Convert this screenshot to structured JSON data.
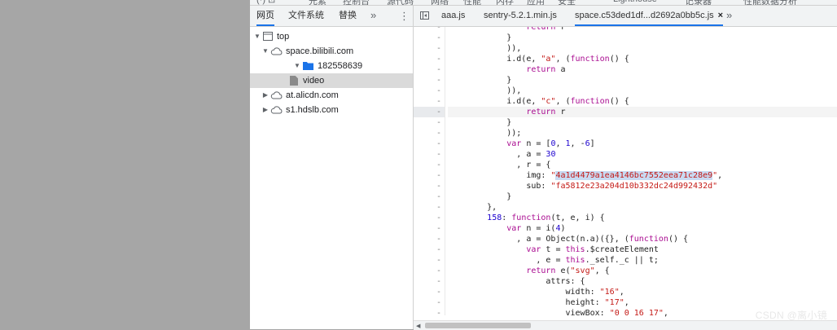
{
  "top_toolbar": {
    "fragments": [
      "(·) ⊡",
      "元素",
      "控制台",
      "源代码",
      "网络",
      "性能",
      "内存",
      "应用",
      "安全",
      "Lighthouse",
      "记录器",
      "性能数据分析"
    ]
  },
  "navigator": {
    "tabs": [
      {
        "label": "网页",
        "active": true
      },
      {
        "label": "文件系统",
        "active": false
      },
      {
        "label": "替换",
        "active": false
      }
    ],
    "more": "»",
    "menu": "⋮",
    "tree": [
      {
        "label": "top",
        "icon": "frame-icon",
        "expanded": true,
        "selected": false
      },
      {
        "label": "space.bilibili.com",
        "icon": "cloud-icon",
        "expanded": true,
        "selected": false
      },
      {
        "label": "182558639",
        "icon": "folder-icon",
        "expanded": true,
        "selected": false
      },
      {
        "label": "video",
        "icon": "file-icon",
        "expanded": false,
        "selected": true
      },
      {
        "label": "at.alicdn.com",
        "icon": "cloud-icon",
        "expanded": false,
        "selected": false
      },
      {
        "label": "s1.hdslb.com",
        "icon": "cloud-icon",
        "expanded": false,
        "selected": false
      }
    ]
  },
  "editor": {
    "tabs": [
      {
        "label": "aaa.js",
        "active": false
      },
      {
        "label": "sentry-5.2.1.min.js",
        "active": false
      },
      {
        "label": "space.c53ded1df...d2692a0bb5c.js",
        "active": true
      }
    ],
    "close": "×",
    "more": "»",
    "gutter_mark": "-",
    "highlight_line": 8,
    "selection": "4a1d4479a1ea4146bc7552eea71c28e9",
    "code_lines": [
      "                return r",
      "            }",
      "            )),",
      "            i.d(e, \"a\", (function() {",
      "                return a",
      "            }",
      "            )),",
      "            i.d(e, \"c\", (function() {",
      "                return r",
      "            }",
      "            ));",
      "            var n = [0, 1, -6]",
      "              , a = 30",
      "              , r = {",
      "                img: \"4a1d4479a1ea4146bc7552eea71c28e9\",",
      "                sub: \"fa5812e23a204d10b332dc24d992432d\"",
      "            }",
      "        },",
      "        158: function(t, e, i) {",
      "            var n = i(4)",
      "              , a = Object(n.a)({}, (function() {",
      "                var t = this.$createElement",
      "                  , e = this._self._c || t;",
      "                return e(\"svg\", {",
      "                    attrs: {",
      "                        width: \"16\",",
      "                        height: \"17\",",
      "                        viewBox: \"0 0 16 17\",",
      "                        "
    ]
  },
  "watermark": "CSDN @离小镜"
}
